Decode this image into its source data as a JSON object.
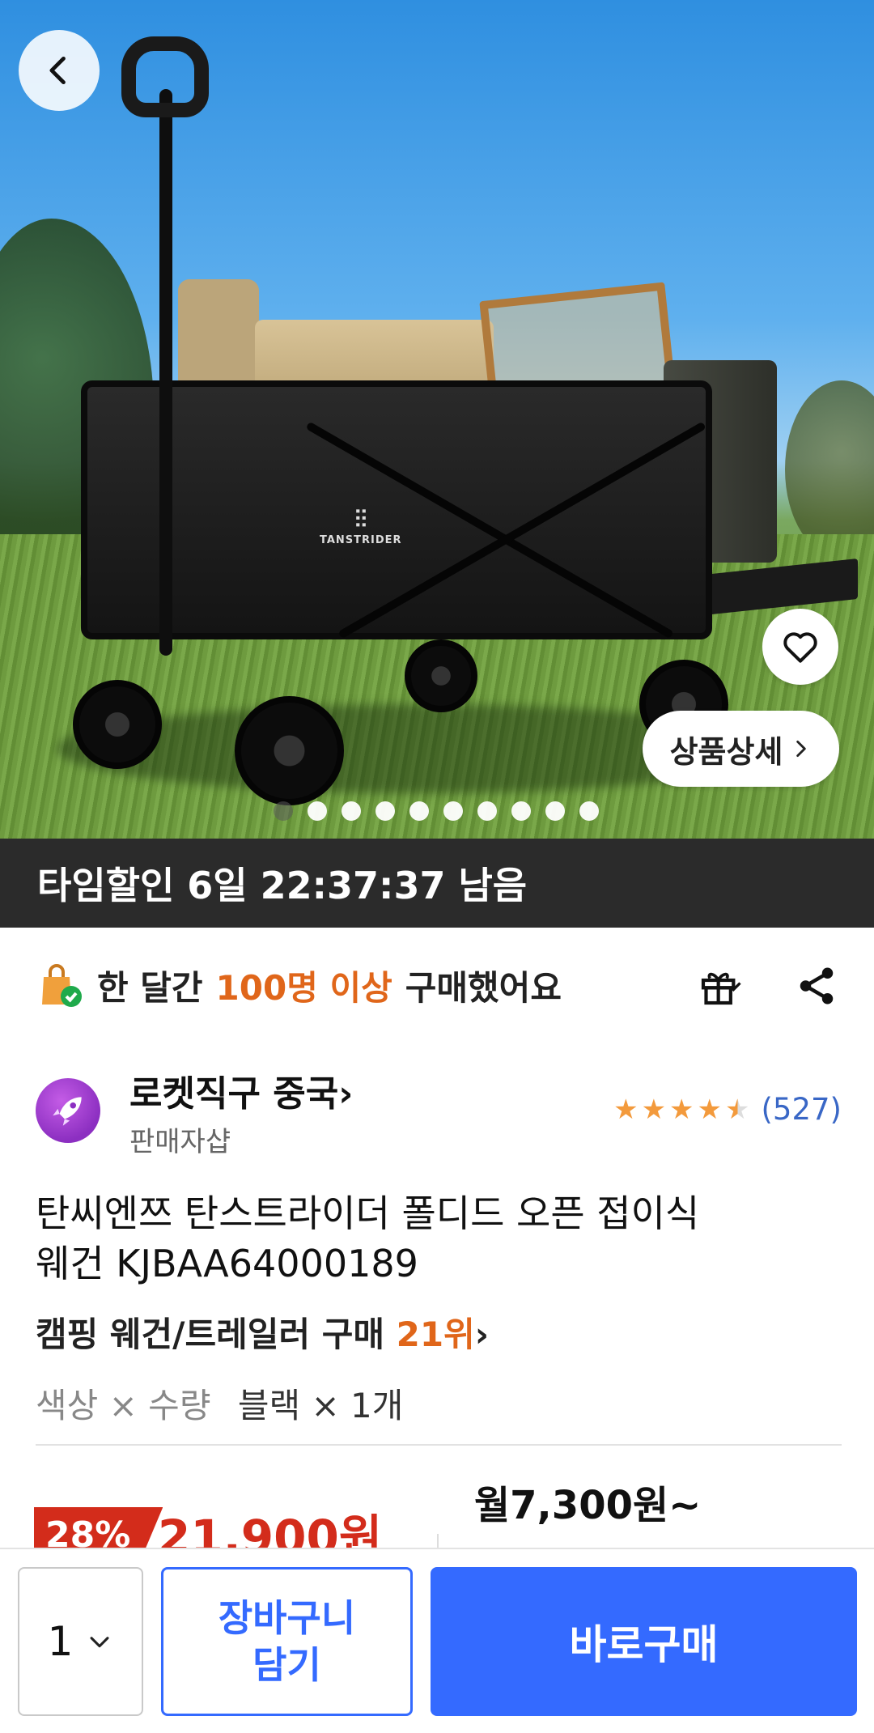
{
  "hero": {
    "brand_text": "TANSTRIDER",
    "detail_button_label": "상품상세",
    "carousel_dots": 10,
    "carousel_active_index": 0
  },
  "timer": {
    "text": "타임할인 6일 22:37:37 남음"
  },
  "purchase_info": {
    "prefix": "한 달간",
    "highlight": "100명 이상",
    "suffix": "구매했어요"
  },
  "seller": {
    "name": "로켓직구 중국",
    "sub_label": "판매자샵",
    "rating": 4.5,
    "review_count": "(527)"
  },
  "product": {
    "title_line1": "탄씨엔쯔 탄스트라이더 폴디드 오픈 접이식",
    "title_line2": "웨건 KJBAA64000189",
    "ranking_prefix": "캠핑 웨건/트레일러 구매",
    "ranking_value": "21위",
    "option_label": "색상 × 수량",
    "option_value": "블랙 × 1개"
  },
  "price": {
    "discount": "28%",
    "sale_price": "21,900원",
    "monthly": "월7,300원~"
  },
  "bottom_bar": {
    "quantity": "1",
    "cart_label_line1": "장바구니",
    "cart_label_line2": "담기",
    "buy_label": "바로구매"
  },
  "colors": {
    "accent_blue": "#346aff",
    "sale_red": "#d32c1b",
    "highlight_orange": "#e0661a",
    "star_orange": "#f39a3c"
  },
  "icons": [
    "back-icon",
    "heart-icon",
    "chevron-right-icon",
    "shopping-bag-check-icon",
    "gift-icon",
    "share-icon",
    "rocket-icon",
    "chevron-down-icon"
  ]
}
